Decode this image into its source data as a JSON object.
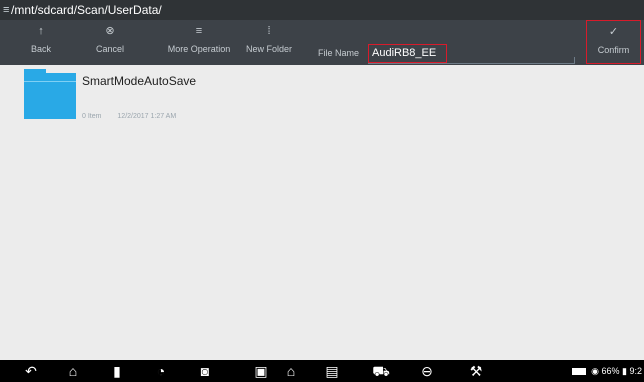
{
  "path_bar": {
    "menu_icon": "menu-icon",
    "path": "/mnt/sdcard/Scan/UserData/"
  },
  "toolbar": {
    "back": {
      "label": "Back",
      "icon": "↑"
    },
    "cancel": {
      "label": "Cancel",
      "icon": "⊗"
    },
    "more": {
      "label": "More Operation",
      "icon": "≡"
    },
    "new_folder": {
      "label": "New Folder",
      "icon": "⁞"
    },
    "file_name_label": "File Name",
    "file_name_value": "AudiRB8_EE",
    "confirm": {
      "label": "Confirm",
      "icon": "✓"
    }
  },
  "files": [
    {
      "name": "SmartModeAutoSave",
      "meta": [
        "0 Item",
        "12/2/2017 1:27 AM"
      ]
    }
  ],
  "status": {
    "battery": "66%",
    "time": "9:2"
  },
  "colors": {
    "highlight": "#d81b2b",
    "folder": "#29a9e6",
    "toolbar": "#3d4248",
    "path_bar": "#2f3336"
  }
}
